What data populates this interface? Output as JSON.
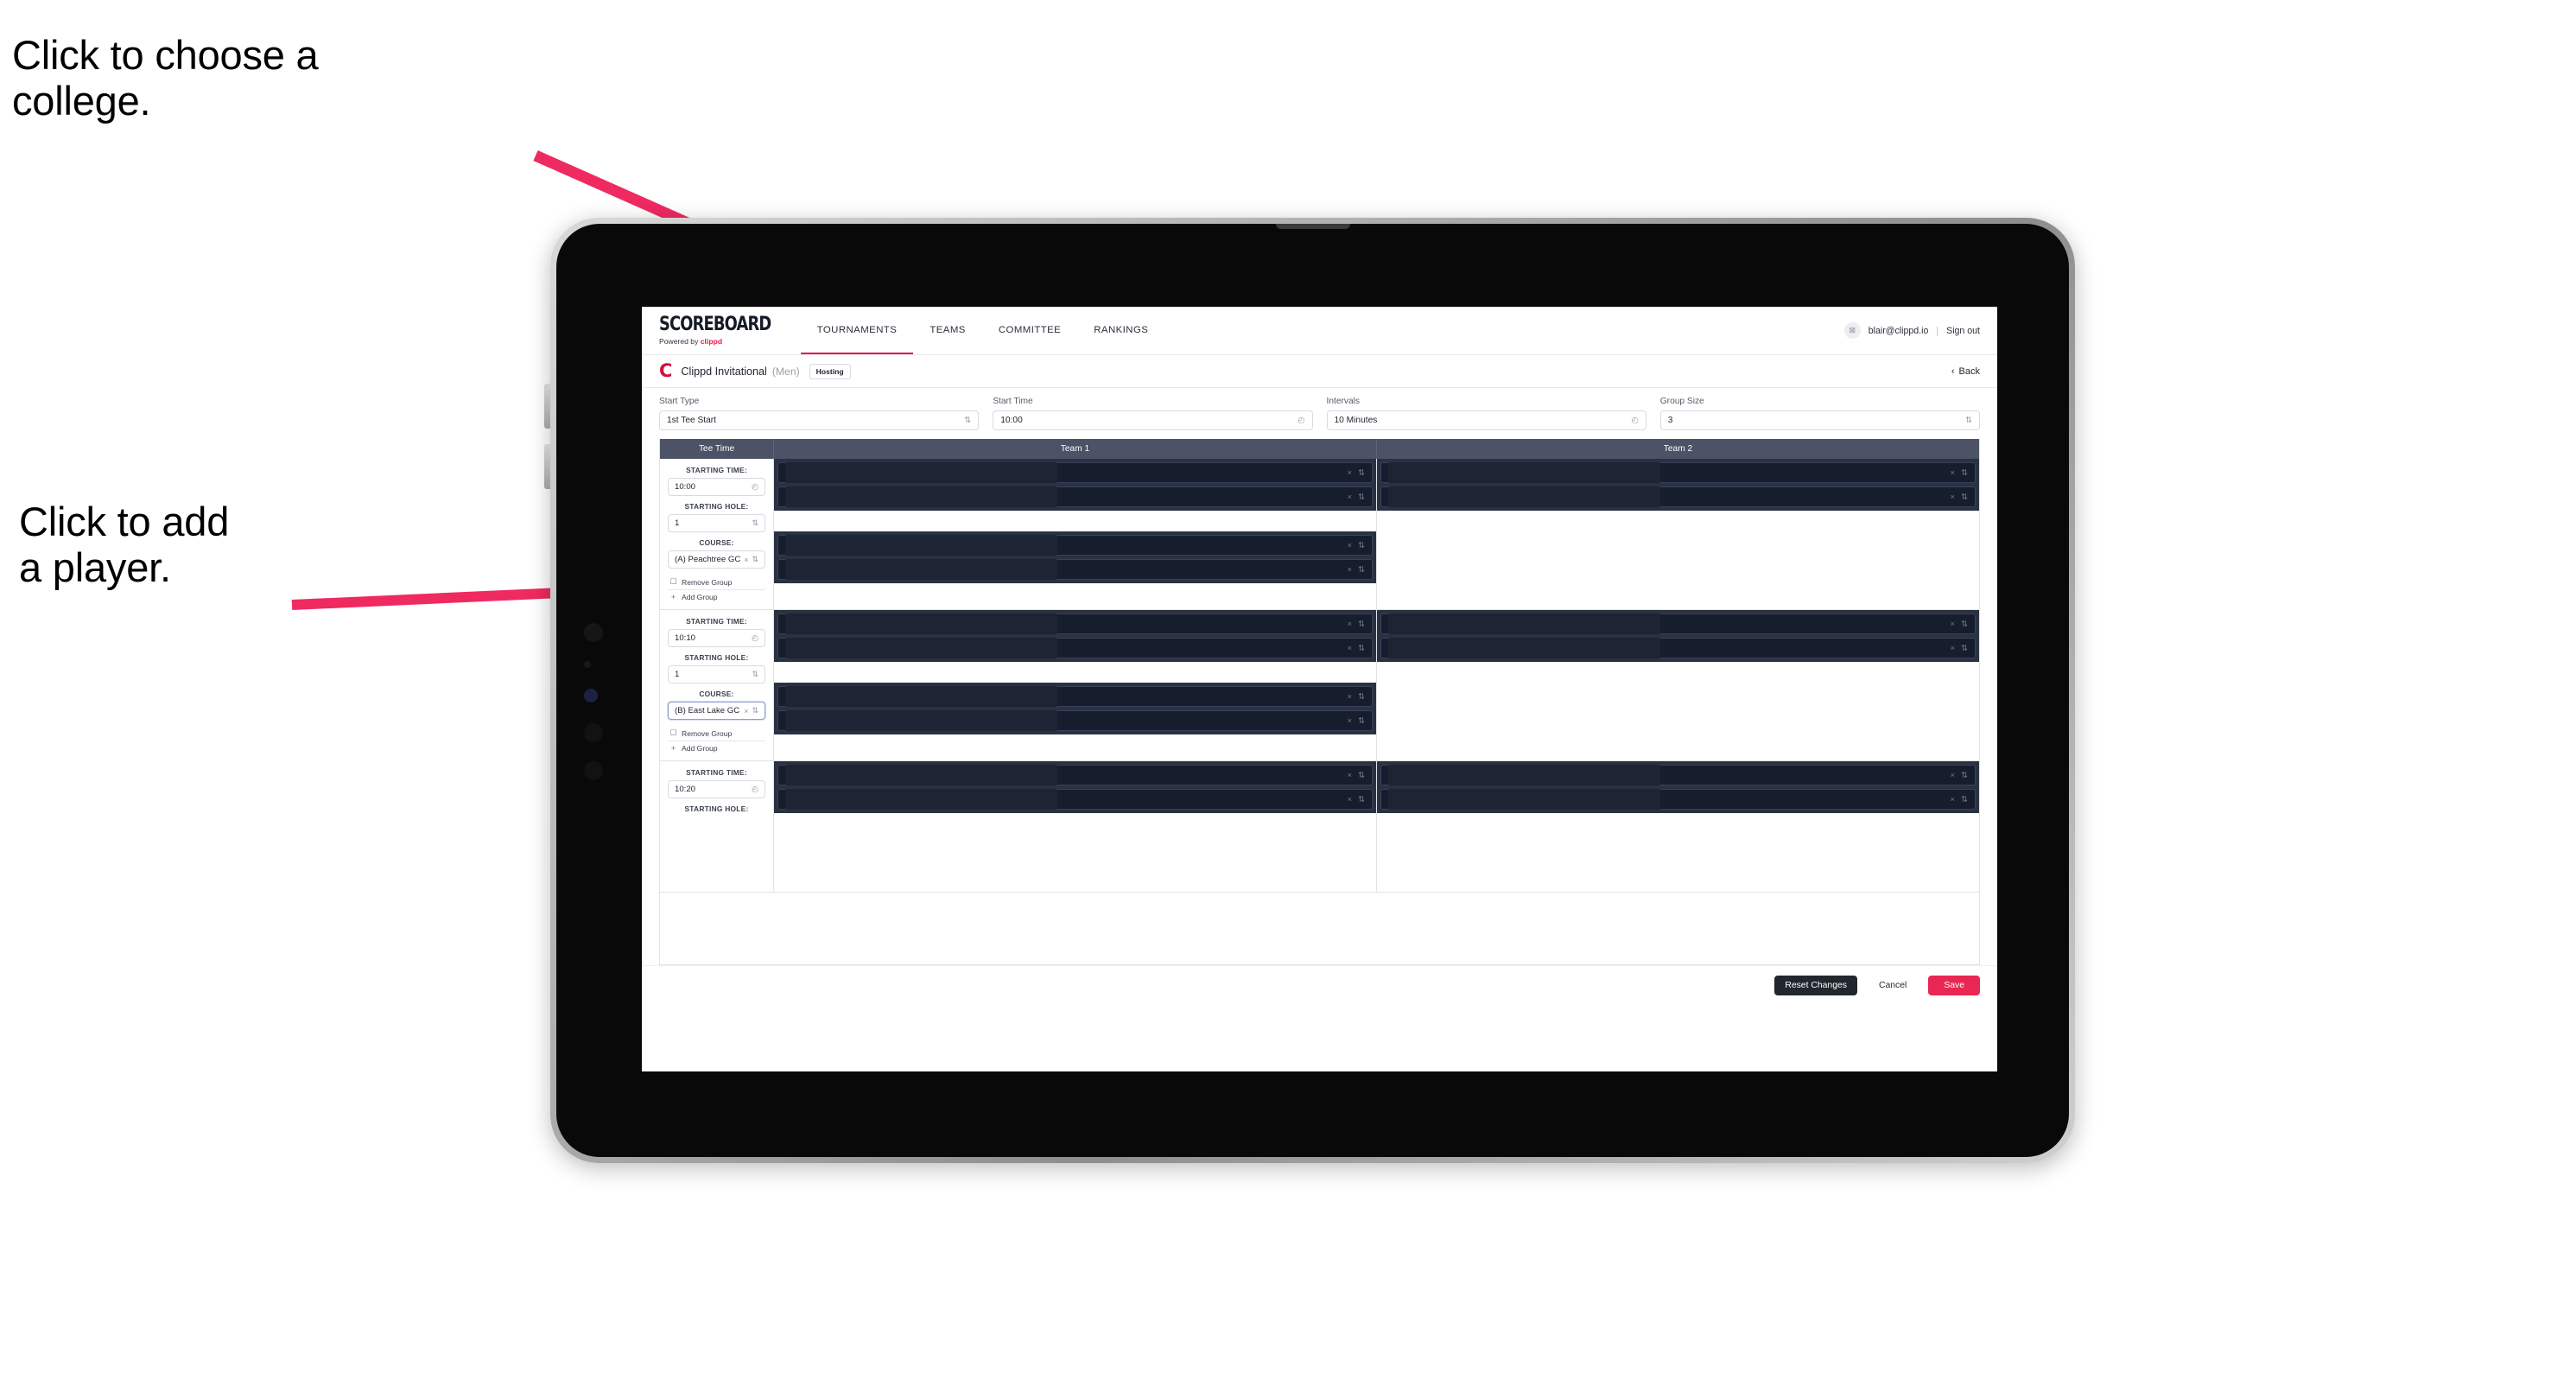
{
  "annotations": {
    "college": "Click to choose a\ncollege.",
    "player": "Click to add\na player.",
    "arrow_color": "#ef2a61"
  },
  "app": {
    "header": {
      "logo_main": "SCOREBOARD",
      "logo_sub_prefix": "Powered by ",
      "logo_sub_brand": "clippd",
      "nav": [
        {
          "label": "TOURNAMENTS",
          "active": true
        },
        {
          "label": "TEAMS",
          "active": false
        },
        {
          "label": "COMMITTEE",
          "active": false
        },
        {
          "label": "RANKINGS",
          "active": false
        }
      ],
      "avatar_glyph": "⊠",
      "user_email": "blair@clippd.io",
      "separator": "|",
      "sign_out": "Sign out"
    },
    "tournament_bar": {
      "brand_mark": "C",
      "name": "Clippd Invitational",
      "gender": "(Men)",
      "badge": "Hosting",
      "back_chevron": "‹",
      "back_label": "Back"
    },
    "controls": [
      {
        "label": "Start Type",
        "value": "1st Tee Start",
        "icon": "stepper-icon",
        "glyph": "⇅"
      },
      {
        "label": "Start Time",
        "value": "10:00",
        "icon": "clock-icon",
        "glyph": "◴"
      },
      {
        "label": "Intervals",
        "value": "10 Minutes",
        "icon": "clock-icon",
        "glyph": "◴"
      },
      {
        "label": "Group Size",
        "value": "3",
        "icon": "stepper-icon",
        "glyph": "⇅"
      }
    ],
    "table": {
      "columns": [
        "Tee Time",
        "Team 1",
        "Team 2"
      ],
      "field_labels": {
        "starting_time": "STARTING TIME:",
        "starting_hole": "STARTING HOLE:",
        "course": "COURSE:"
      },
      "group_actions": {
        "remove": "Remove Group",
        "remove_icon_glyph": "☐",
        "add": "Add Group",
        "add_icon_glyph": "+"
      },
      "row_icons": {
        "clear_glyph": "×",
        "stepper_glyph": "⇅"
      },
      "rows": [
        {
          "starting_time": "10:00",
          "starting_hole": "1",
          "course": "(A) Peachtree GC",
          "course_focused": false,
          "team1_groups": [
            2,
            2
          ],
          "team2_groups": [
            2
          ]
        },
        {
          "starting_time": "10:10",
          "starting_hole": "1",
          "course": "(B) East Lake GC",
          "course_focused": true,
          "team1_groups": [
            2,
            2
          ],
          "team2_groups": [
            2
          ]
        },
        {
          "starting_time": "10:20",
          "starting_hole": "",
          "course": "",
          "course_focused": false,
          "team1_groups": [
            2
          ],
          "team2_groups": [
            2
          ]
        }
      ]
    },
    "footer": {
      "reset": "Reset Changes",
      "cancel": "Cancel",
      "save": "Save"
    },
    "colors": {
      "accent": "#e8194b",
      "save": "#e82753",
      "table_header": "#4c5366",
      "player_block": "#2a3242"
    }
  }
}
